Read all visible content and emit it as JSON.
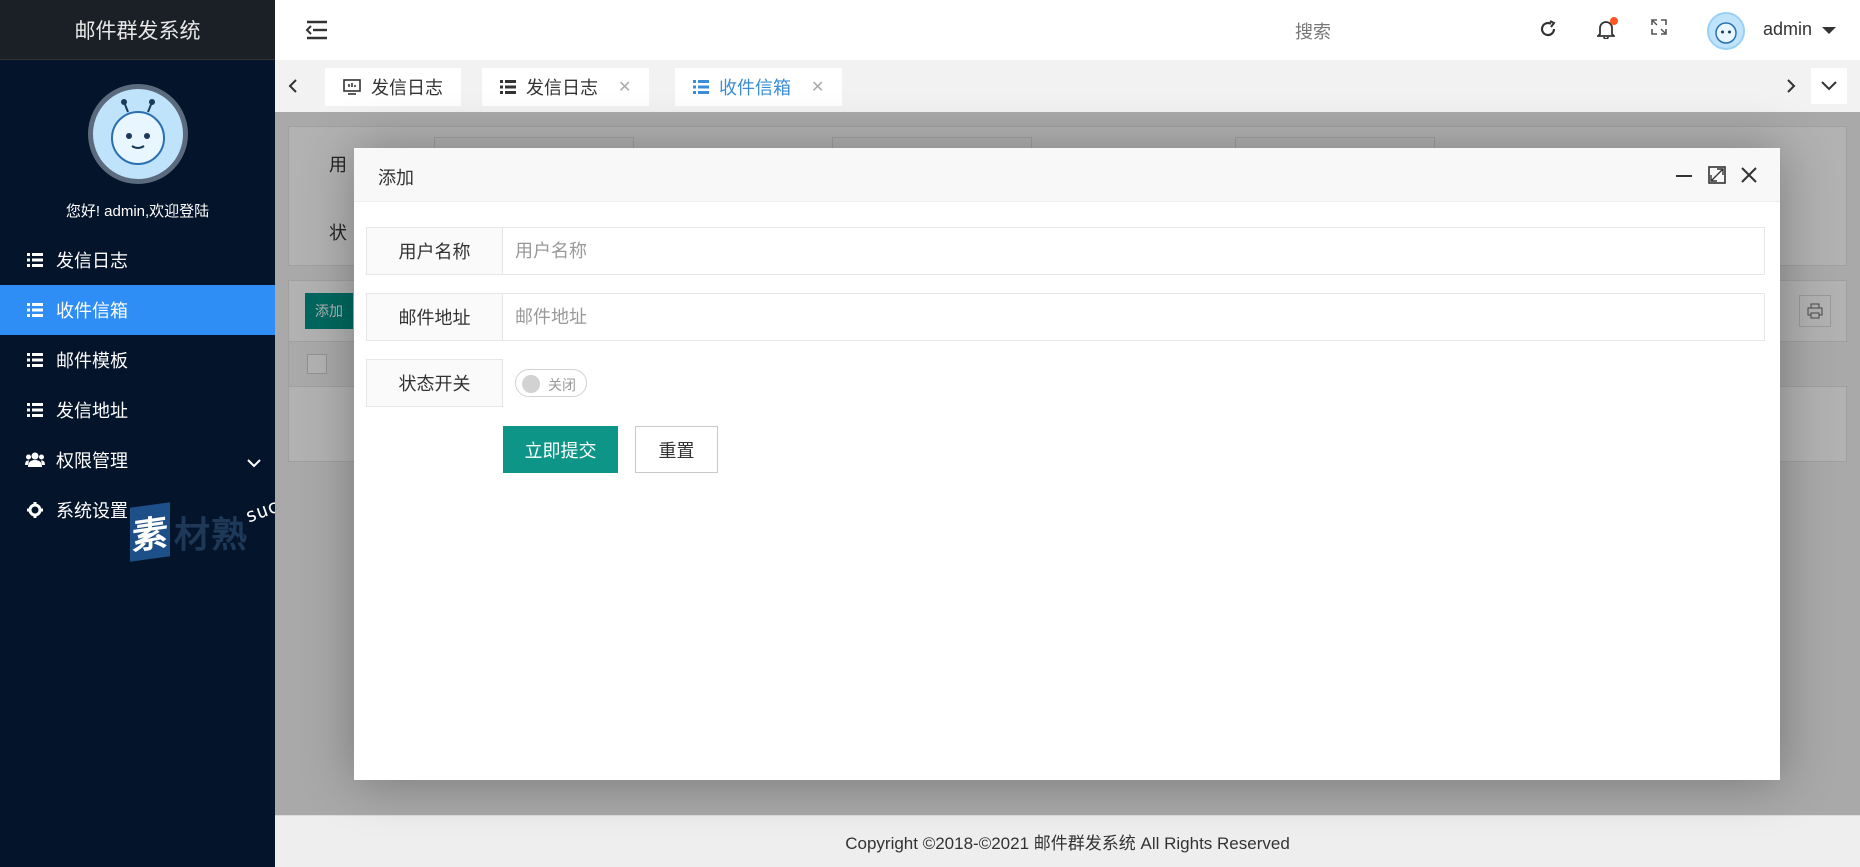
{
  "app": {
    "title": "邮件群发系统"
  },
  "sidebar": {
    "welcome": "您好! admin,欢迎登陆",
    "items": [
      {
        "label": "发信日志",
        "icon": "list-icon",
        "active": false
      },
      {
        "label": "收件信箱",
        "icon": "list-icon",
        "active": true
      },
      {
        "label": "邮件模板",
        "icon": "list-icon",
        "active": false
      },
      {
        "label": "发信地址",
        "icon": "list-icon",
        "active": false
      },
      {
        "label": "权限管理",
        "icon": "users-icon",
        "active": false
      },
      {
        "label": "系统设置",
        "icon": "gear-icon",
        "active": false
      }
    ],
    "watermark": {
      "mark": "素",
      "text": "材熟",
      "url": "sucaire.com"
    }
  },
  "header": {
    "search_placeholder": "搜索",
    "username": "admin"
  },
  "tabs": [
    {
      "label": "发信日志",
      "icon": "monitor-icon",
      "closable": false
    },
    {
      "label": "发信日志",
      "icon": "list-icon",
      "closable": true
    },
    {
      "label": "收件信箱",
      "icon": "list-icon",
      "closable": true,
      "active": true
    }
  ],
  "background": {
    "label_user": "用",
    "label_status": "状",
    "add_button": "添加"
  },
  "dialog": {
    "title": "添加",
    "fields": {
      "username": {
        "label": "用户名称",
        "placeholder": "用户名称",
        "value": ""
      },
      "email": {
        "label": "邮件地址",
        "placeholder": "邮件地址",
        "value": ""
      },
      "status": {
        "label": "状态开关",
        "switch_text": "关闭",
        "on": false
      }
    },
    "submit_label": "立即提交",
    "reset_label": "重置"
  },
  "footer": {
    "text": "Copyright ©2018-©2021 邮件群发系统 All Rights Reserved"
  },
  "colors": {
    "sidebar_bg": "#04142a",
    "active": "#2f8ef5",
    "primary": "#0d9688",
    "tab_active": "#3a8dd6"
  }
}
